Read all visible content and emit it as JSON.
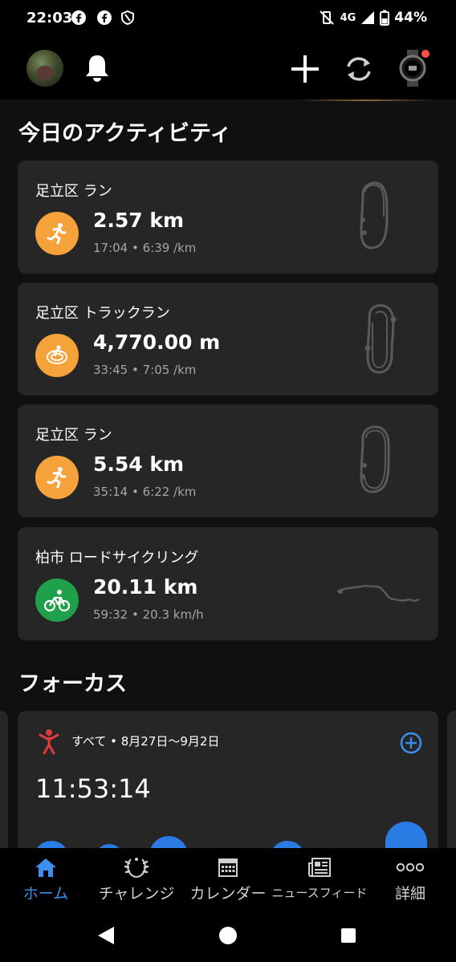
{
  "status_bar": {
    "time": "22:03",
    "network": "4G",
    "battery": "44%"
  },
  "activities_title": "今日のアクティビティ",
  "activities": [
    {
      "title": "足立区 ラン",
      "value": "2.57 km",
      "sub": "17:04 • 6:39 /km",
      "icon": "running-icon",
      "color": "#f6a23a"
    },
    {
      "title": "足立区 トラックラン",
      "value": "4,770.00 m",
      "sub": "33:45 • 7:05 /km",
      "icon": "track-running-icon",
      "color": "#f6a23a"
    },
    {
      "title": "足立区 ラン",
      "value": "5.54 km",
      "sub": "35:14 • 6:22 /km",
      "icon": "running-icon",
      "color": "#f6a23a"
    },
    {
      "title": "柏市 ロードサイクリング",
      "value": "20.11 km",
      "sub": "59:32 • 20.3 km/h",
      "icon": "cycling-icon",
      "color": "#1fa14b"
    }
  ],
  "focus_title": "フォーカス",
  "focus": {
    "label": "すべて • 8月27日〜9月2日",
    "time": "11:53:14",
    "accent": "#2a7be4"
  },
  "bottom_nav": [
    {
      "label": "ホーム",
      "icon": "home-icon",
      "active": true
    },
    {
      "label": "チャレンジ",
      "icon": "laurel-icon",
      "active": false
    },
    {
      "label": "カレンダー",
      "icon": "calendar-icon",
      "active": false
    },
    {
      "label": "ニュースフィード",
      "icon": "newsfeed-icon",
      "active": false
    },
    {
      "label": "詳細",
      "icon": "more-icon",
      "active": false
    }
  ]
}
